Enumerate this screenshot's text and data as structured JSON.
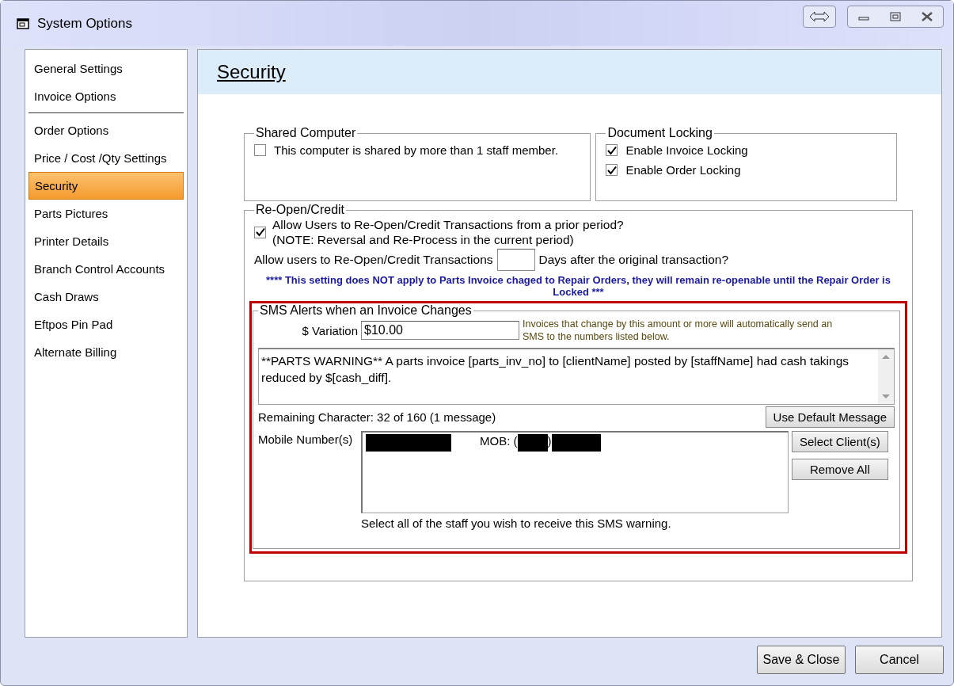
{
  "window": {
    "title": "System Options"
  },
  "sidebar": {
    "groups": [
      {
        "items": [
          {
            "label": "General Settings",
            "selected": false
          },
          {
            "label": "Invoice Options",
            "selected": false
          }
        ]
      },
      {
        "items": [
          {
            "label": "Order Options",
            "selected": false
          },
          {
            "label": "Price / Cost /Qty Settings",
            "selected": false
          },
          {
            "label": "Security",
            "selected": true
          },
          {
            "label": "Parts Pictures",
            "selected": false
          },
          {
            "label": "Printer Details",
            "selected": false
          },
          {
            "label": "Branch Control Accounts",
            "selected": false
          },
          {
            "label": "Cash Draws",
            "selected": false
          },
          {
            "label": "Eftpos Pin Pad",
            "selected": false
          },
          {
            "label": "Alternate Billing",
            "selected": false
          }
        ]
      }
    ]
  },
  "page": {
    "title": "Security",
    "shared_computer": {
      "legend": "Shared Computer",
      "checkboxes": [
        {
          "label": "This computer is shared by more than 1 staff member.",
          "checked": false
        }
      ]
    },
    "document_locking": {
      "legend": "Document Locking",
      "checkboxes": [
        {
          "label": "Enable Invoice Locking",
          "checked": true
        },
        {
          "label": "Enable Order Locking",
          "checked": true
        }
      ]
    },
    "reopen_credit": {
      "legend": "Re-Open/Credit",
      "checkbox": {
        "label": "Allow Users to Re-Open/Credit Transactions from a prior period?",
        "note": "(NOTE: Reversal and Re-Process in the current period)",
        "checked": true
      },
      "days_label": "Allow users to Re-Open/Credit Transactions",
      "days_suffix": "Days after the original transaction?",
      "warning": "**** This setting does NOT apply to Parts Invoice chaged to Repair Orders, they will remain re-openable until the Repair Order is Locked ***"
    },
    "sms_alerts": {
      "legend": "SMS Alerts when an Invoice Changes",
      "highlighted": true,
      "variation_label": "$ Variation",
      "variation_value": "$10.00",
      "variation_hint": "Invoices that change by this amount or more will automatically send an SMS to the numbers listed below.",
      "message": "**PARTS WARNING** A parts invoice [parts_inv_no] to [clientName] posted by [staffName] had cash takings reduced by $[cash_diff].",
      "remaining": "Remaining Character: 32 of 160 (1 message)",
      "default_button": "Use Default Message",
      "mobile_label": "Mobile Number(s)",
      "mobile_parts": [
        {
          "kind": "redacted"
        },
        {
          "kind": "text",
          "text": "MOB: ("
        },
        {
          "kind": "redacted"
        },
        {
          "kind": "text",
          "text": ")"
        },
        {
          "kind": "redacted"
        }
      ],
      "buttons": [
        "Select Client(s)",
        "Remove All"
      ],
      "footer": "Select all of the staff you wish to receive this SMS warning."
    }
  },
  "buttons": [
    "Save & Close",
    "Cancel"
  ]
}
